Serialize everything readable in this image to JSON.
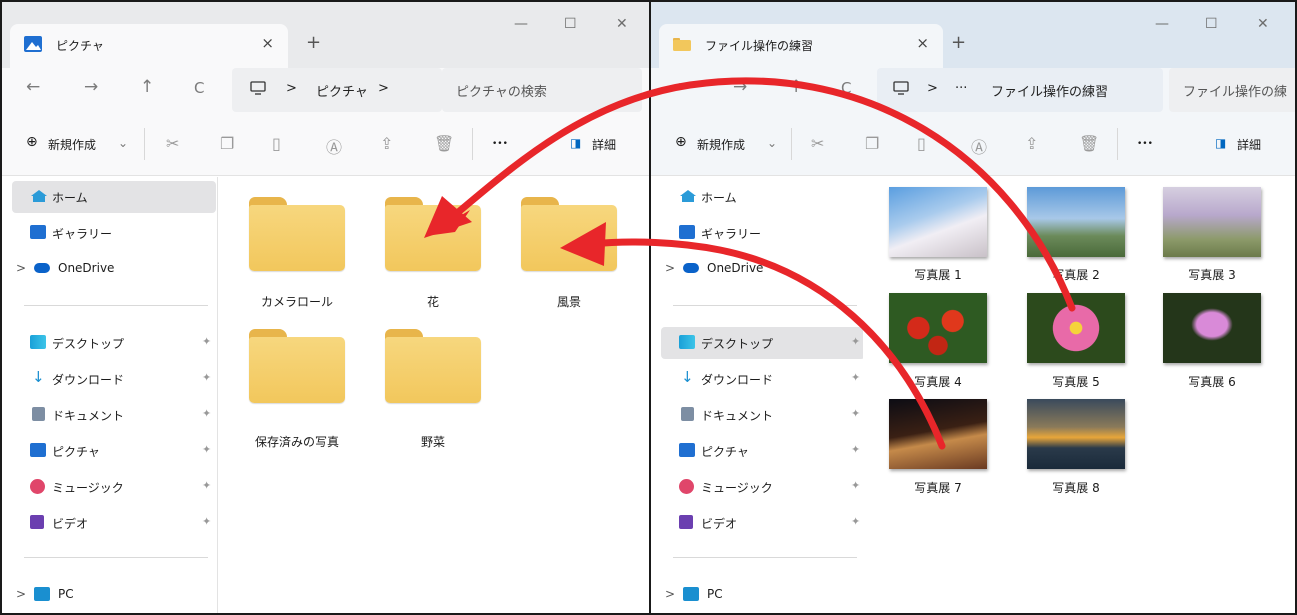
{
  "left_window": {
    "tab_title": "ピクチャ",
    "tab_close": "×",
    "new_tab": "+",
    "controls": {
      "minimize": "—",
      "maximize": "☐",
      "close": "✕"
    },
    "nav": {
      "back": "←",
      "forward": "→",
      "up": "↑",
      "refresh": "C"
    },
    "breadcrumb": {
      "sep": ">",
      "current": "ピクチャ",
      "trailing": ">"
    },
    "search_placeholder": "ピクチャの検索",
    "commands": {
      "new": "新規作成",
      "new_caret": "⌄",
      "more": "•••",
      "details": "詳細"
    },
    "folders": [
      "カメラロール",
      "花",
      "風景",
      "保存済みの写真",
      "野菜"
    ]
  },
  "right_window": {
    "tab_title": "ファイル操作の練習",
    "tab_close": "×",
    "new_tab": "+",
    "controls": {
      "minimize": "—",
      "maximize": "☐",
      "close": "✕"
    },
    "nav": {
      "back": "←",
      "forward": "→",
      "up": "↑",
      "refresh": "C"
    },
    "breadcrumb": {
      "sep": ">",
      "ellipsis": "···",
      "current": "ファイル操作の練習"
    },
    "search_placeholder": "ファイル操作の練",
    "commands": {
      "new": "新規作成",
      "new_caret": "⌄",
      "more": "•••",
      "details": "詳細"
    },
    "photos": [
      "写真展 1",
      "写真展 2",
      "写真展 3",
      "写真展 4",
      "写真展 5",
      "写真展 6",
      "写真展 7",
      "写真展 8"
    ]
  },
  "sidebar": {
    "home": "ホーム",
    "gallery": "ギャラリー",
    "onedrive": "OneDrive",
    "desktop": "デスクトップ",
    "downloads": "ダウンロード",
    "documents": "ドキュメント",
    "pictures": "ピクチャ",
    "music": "ミュージック",
    "videos": "ビデオ",
    "pc": "PC",
    "expand": ">",
    "pin": "✦"
  },
  "colors": {
    "arrow": "#e8262a",
    "folder": "#f4cc62",
    "accent": "#0067c0"
  }
}
